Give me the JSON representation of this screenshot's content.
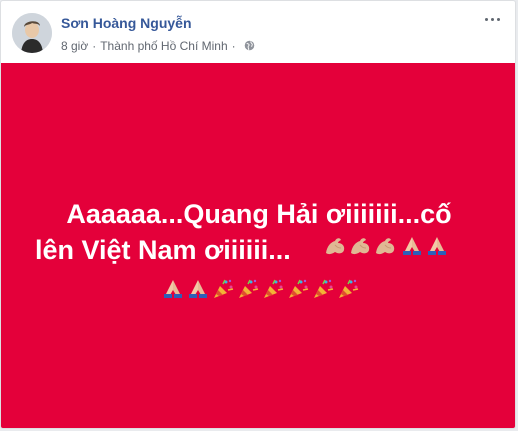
{
  "post": {
    "author": "Sơn Hoàng Nguyễn",
    "time": "8 giờ",
    "separator": "·",
    "location": "Thành phố Hồ Chí Minh",
    "more_icon": "more-options-icon",
    "privacy_icon": "globe-icon"
  },
  "banner": {
    "background_color": "#e4003a",
    "line1": "Aaaaaa...Quang Hải ơiiiiiii...cố",
    "line2": "lên Việt Nam ơiiiiii...",
    "line2_emojis": [
      "flexed-biceps-icon",
      "flexed-biceps-icon",
      "flexed-biceps-icon",
      "folded-hands-icon",
      "folded-hands-icon"
    ],
    "line3_emojis": [
      "folded-hands-icon",
      "folded-hands-icon",
      "party-popper-icon",
      "party-popper-icon",
      "party-popper-icon",
      "party-popper-icon",
      "party-popper-icon",
      "party-popper-icon"
    ]
  }
}
